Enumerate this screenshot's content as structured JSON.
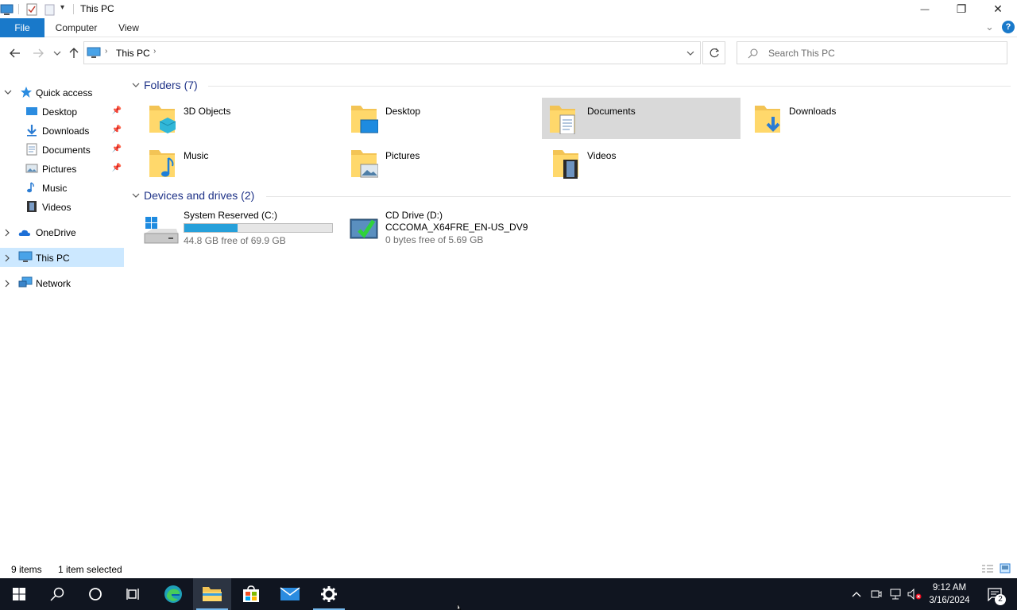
{
  "window": {
    "title": "This PC",
    "minimize_glyph": "—",
    "maximize_glyph": "❐",
    "close_glyph": "✕"
  },
  "ribbon": {
    "tabs": [
      "File",
      "Computer",
      "View"
    ],
    "collapse_glyph": "⌄",
    "help_glyph": "?"
  },
  "address": {
    "path": "This PC",
    "search_placeholder": "Search This PC"
  },
  "nav": {
    "quick_access": "Quick access",
    "quick_items": [
      "Desktop",
      "Downloads",
      "Documents",
      "Pictures",
      "Music",
      "Videos"
    ],
    "onedrive": "OneDrive",
    "this_pc": "This PC",
    "network": "Network"
  },
  "content": {
    "folders_header": "Folders (7)",
    "folders": [
      "3D Objects",
      "Desktop",
      "Documents",
      "Downloads",
      "Music",
      "Pictures",
      "Videos"
    ],
    "selected_folder": "Documents",
    "drives_header": "Devices and drives (2)",
    "drives": [
      {
        "name": "System Reserved (C:)",
        "free": "44.8 GB free of 69.9 GB",
        "used_fraction": 0.36
      },
      {
        "name": "CD Drive (D:)",
        "label": "CCCOMA_X64FRE_EN-US_DV9",
        "free": "0 bytes free of 5.69 GB"
      }
    ]
  },
  "status": {
    "items": "9 items",
    "selected": "1 item selected"
  },
  "taskbar": {
    "time": "9:12 AM",
    "date": "3/16/2024",
    "notifications": "2",
    "accent": "#76b9ed"
  }
}
